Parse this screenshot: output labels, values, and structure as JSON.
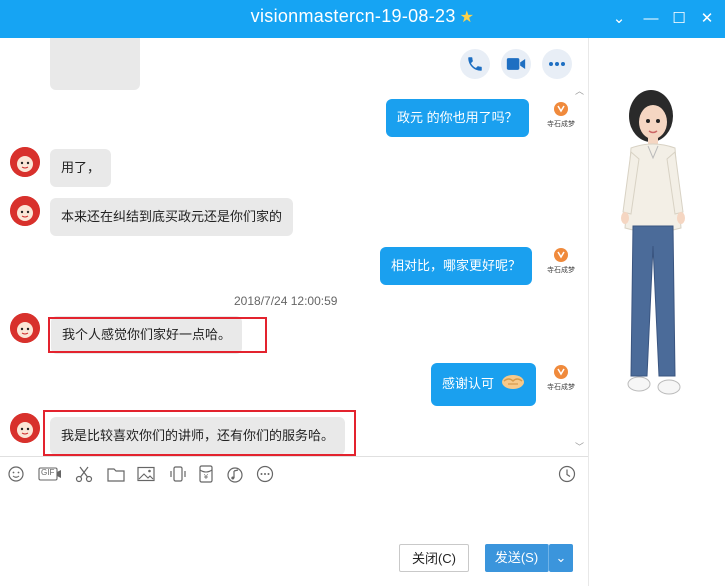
{
  "window": {
    "title": "visionmastercn-19-08-23",
    "minimize": "⌄",
    "restore": "—",
    "maximize": "☐",
    "close": "✕"
  },
  "header_actions": [
    "phone-icon",
    "video-icon",
    "more-icon"
  ],
  "messages": [
    {
      "side": "out",
      "text": "政元  的你也用了吗？"
    },
    {
      "side": "in",
      "text": "用了，"
    },
    {
      "side": "in",
      "text": "本来还在纠结到底买政元还是你们家的"
    },
    {
      "side": "out",
      "text": "相对比，哪家更好呢？"
    },
    {
      "side": "in",
      "text": "我个人感觉你们家好一点哈。"
    },
    {
      "side": "out",
      "text": "感谢认可"
    },
    {
      "side": "in",
      "text": "我是比较喜欢你们的讲师，还有你们的服务哈。"
    }
  ],
  "timestamp": "2018/7/24 12:00:59",
  "brand_logo_text": "寺石成梦",
  "toolbar": [
    "emoji-icon",
    "gif-icon",
    "scissors-icon",
    "folder-icon",
    "image-icon",
    "shake-icon",
    "red-packet-icon",
    "music-icon",
    "more-icon",
    "history-icon"
  ],
  "toolbar_gif_label": "GIF",
  "buttons": {
    "close": "关闭(C)",
    "send": "发送(S)",
    "send_dropdown": "⌄"
  },
  "colors": {
    "titlebar": "#16a4f3",
    "bubble_out": "#1aa0ef",
    "bubble_in": "#e9e9e9",
    "highlight_box": "#e3232e",
    "send_button": "#3b95dc"
  }
}
